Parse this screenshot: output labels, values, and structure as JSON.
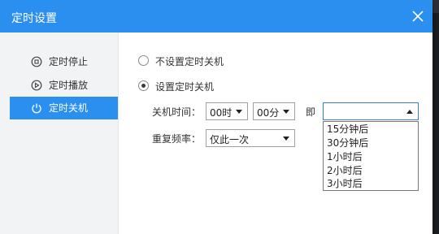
{
  "dialog": {
    "title": "定时设置"
  },
  "sidebar": {
    "items": [
      {
        "label": "定时停止",
        "icon": "stop-circle-icon"
      },
      {
        "label": "定时播放",
        "icon": "play-circle-icon"
      },
      {
        "label": "定时关机",
        "icon": "power-icon",
        "active": true
      }
    ]
  },
  "options": {
    "no_shutdown_label": "不设置定时关机",
    "set_shutdown_label": "设置定时关机",
    "selected": "设置定时关机"
  },
  "shutdown": {
    "time_label": "关机时间：",
    "hour_value": "00时",
    "minute_value": "00分",
    "immediate_label": "即",
    "immediate_value": "",
    "repeat_label": "重复频率：",
    "repeat_value": "仅此一次"
  },
  "immediate_dropdown": {
    "options": [
      "15分钟后",
      "30分钟后",
      "1小时后",
      "2小时后",
      "3小时后"
    ]
  },
  "colors": {
    "accent": "#2b8ff0",
    "sidebar_bg": "#f2f3f5"
  }
}
